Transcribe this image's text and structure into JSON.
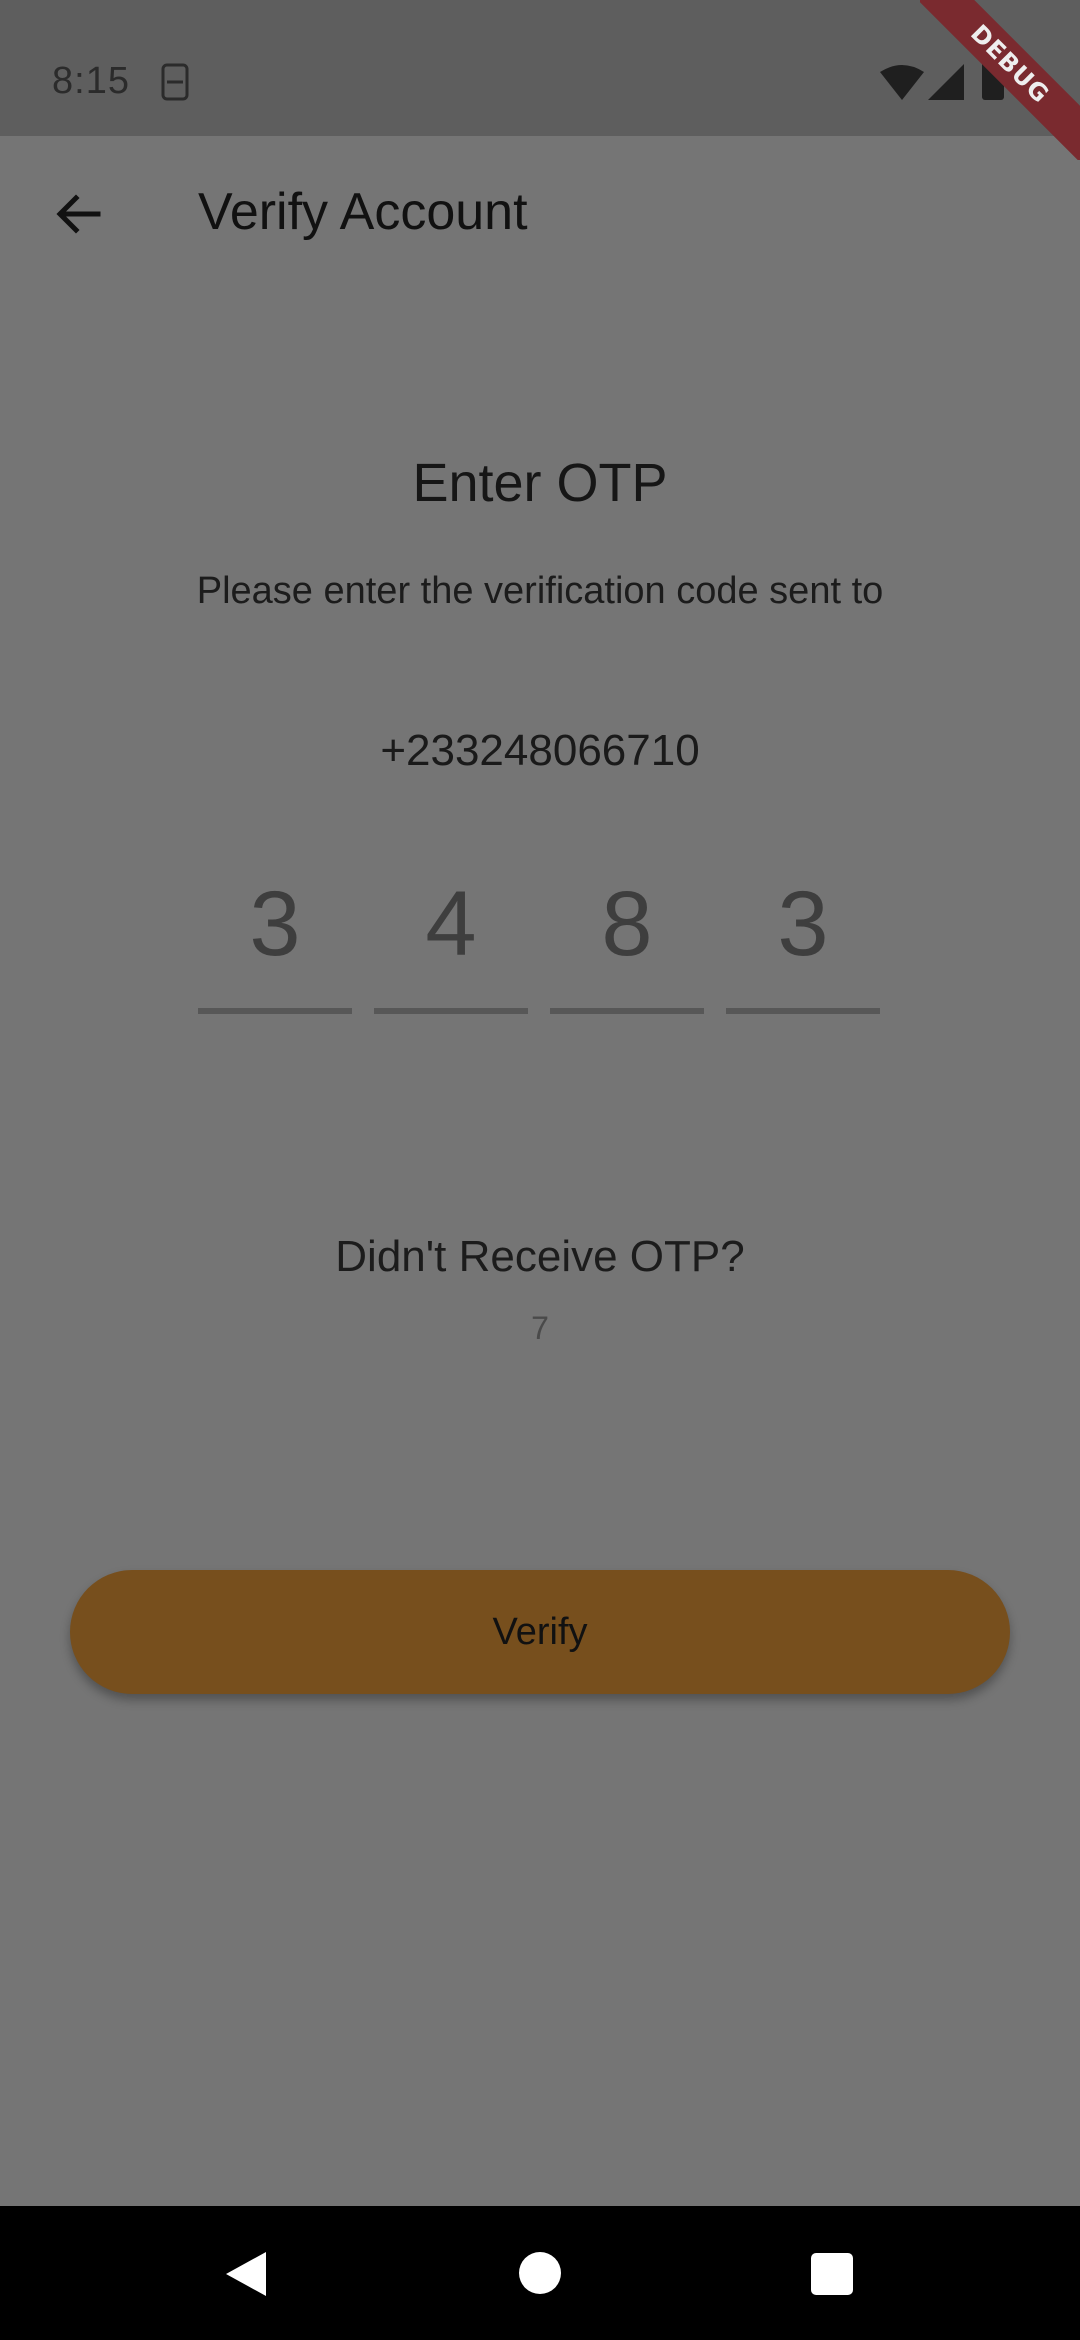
{
  "status_bar": {
    "time": "8:15",
    "icons": [
      "sim-icon",
      "wifi-icon",
      "signal-icon",
      "battery-icon"
    ]
  },
  "debug_banner": "DEBUG",
  "app_bar": {
    "title": "Verify Account",
    "back_icon": "arrow-back-icon"
  },
  "content": {
    "heading": "Enter OTP",
    "instruction": "Please enter the verification code sent to",
    "phone_number": "+233248066710",
    "otp_digits": [
      "3",
      "4",
      "8",
      "3"
    ],
    "resend_label": "Didn't Receive OTP?",
    "timer": "7"
  },
  "verify_button": {
    "label": "Verify"
  },
  "colors": {
    "background": "#757575",
    "status_bar": "#5e5e5e",
    "accent": "#774f1d",
    "debug_banner": "#7a2a2f"
  },
  "nav_bar": {
    "icons": [
      "nav-back-icon",
      "nav-home-icon",
      "nav-recents-icon"
    ]
  }
}
